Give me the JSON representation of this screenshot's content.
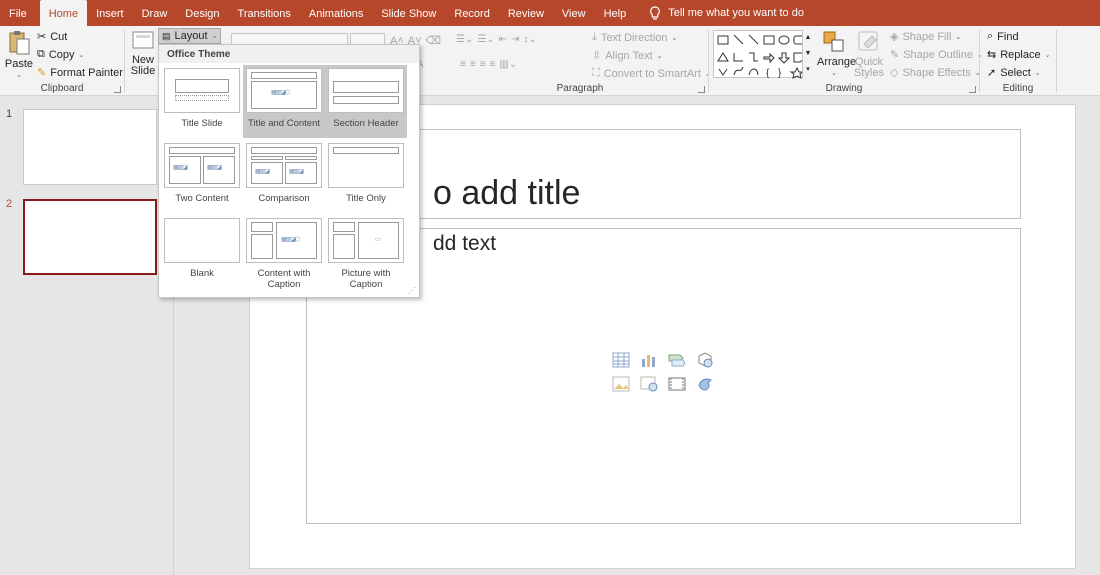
{
  "tabs": [
    "File",
    "Home",
    "Insert",
    "Draw",
    "Design",
    "Transitions",
    "Animations",
    "Slide Show",
    "Record",
    "Review",
    "View",
    "Help"
  ],
  "active_tab": "Home",
  "tell_me": "Tell me what you want to do",
  "clipboard": {
    "paste": "Paste",
    "cut": "Cut",
    "copy": "Copy",
    "format_painter": "Format Painter",
    "label": "Clipboard"
  },
  "slides_group": {
    "new_slide_line1": "New",
    "new_slide_line2": "Slide",
    "layout": "Layout"
  },
  "paragraph": {
    "text_direction": "Text Direction",
    "align_text": "Align Text",
    "convert_smartart": "Convert to SmartArt",
    "label": "Paragraph"
  },
  "drawing": {
    "arrange": "Arrange",
    "quick_styles_line1": "Quick",
    "quick_styles_line2": "Styles",
    "shape_fill": "Shape Fill",
    "shape_outline": "Shape Outline",
    "shape_effects": "Shape Effects",
    "label": "Drawing"
  },
  "editing": {
    "find": "Find",
    "replace": "Replace",
    "select": "Select",
    "label": "Editing"
  },
  "layout_menu": {
    "header": "Office Theme",
    "items": [
      {
        "label1": "Title Slide",
        "label2": ""
      },
      {
        "label1": "Title and Content",
        "label2": ""
      },
      {
        "label1": "Section Header",
        "label2": ""
      },
      {
        "label1": "Two Content",
        "label2": ""
      },
      {
        "label1": "Comparison",
        "label2": ""
      },
      {
        "label1": "Title Only",
        "label2": ""
      },
      {
        "label1": "Blank",
        "label2": ""
      },
      {
        "label1": "Content with",
        "label2": "Caption"
      },
      {
        "label1": "Picture with",
        "label2": "Caption"
      }
    ],
    "highlighted": "Title and Content"
  },
  "slides": [
    "1",
    "2"
  ],
  "slide": {
    "title_placeholder": "Click to add title",
    "body_placeholder": "Click to add text",
    "visible_title": "o add title",
    "visible_body": "dd text"
  },
  "colors": {
    "accent": "#b7472a",
    "selection": "#8b1a1a"
  }
}
